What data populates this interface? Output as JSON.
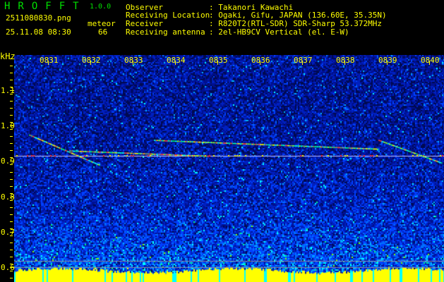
{
  "app": {
    "name": "HROFFT",
    "version": "1.0.0"
  },
  "file": {
    "name": "2511080830.png",
    "timestamp": "25.11.08 08:30"
  },
  "meteor": {
    "label": "meteor",
    "count": "66"
  },
  "info": [
    {
      "key": "Observer",
      "value": "Takanori Kawachi"
    },
    {
      "key": "Receiving Location",
      "value": "Ogaki, Gifu, JAPAN (136.60E, 35.35N)"
    },
    {
      "key": "Receiver",
      "value": "R820T2(RTL-SDR) SDR-Sharp 53.372MHz"
    },
    {
      "key": "Receiving antenna",
      "value": "2el-HB9CV Vertical (el. E-W)"
    }
  ],
  "chart_data": {
    "type": "heatmap",
    "ylabel": "kHz",
    "ylim": [
      0.558,
      1.2
    ],
    "yticks": [
      "1.1",
      "1.0",
      "0.9",
      "0.8",
      "0.7",
      "0.6"
    ],
    "ytick_values": [
      1.1,
      1.0,
      0.9,
      0.8,
      0.7,
      0.6
    ],
    "xticks": [
      "0831",
      "0832",
      "0833",
      "0834",
      "0835",
      "0836",
      "0837",
      "0838",
      "0839",
      "0840"
    ],
    "xlim_minutes": [
      30.2,
      40.35
    ],
    "carrier_khz": 0.915,
    "reference_lines_khz": [
      0.617,
      0.599
    ],
    "echoes": [
      {
        "t0": 30.55,
        "f0": 0.975,
        "t1": 32.2,
        "f1": 0.89
      },
      {
        "t0": 38.8,
        "f0": 0.96,
        "t1": 40.3,
        "f1": 0.895
      },
      {
        "t0": 31.5,
        "f0": 0.93,
        "t1": 34.8,
        "f1": 0.915
      },
      {
        "t0": 33.5,
        "f0": 0.96,
        "t1": 38.8,
        "f1": 0.935
      }
    ],
    "colors": {
      "low": "#000a60",
      "mid": "#0040ff",
      "high": "#00ffff",
      "peak": "#ffff00",
      "label": "#ffff00"
    }
  }
}
